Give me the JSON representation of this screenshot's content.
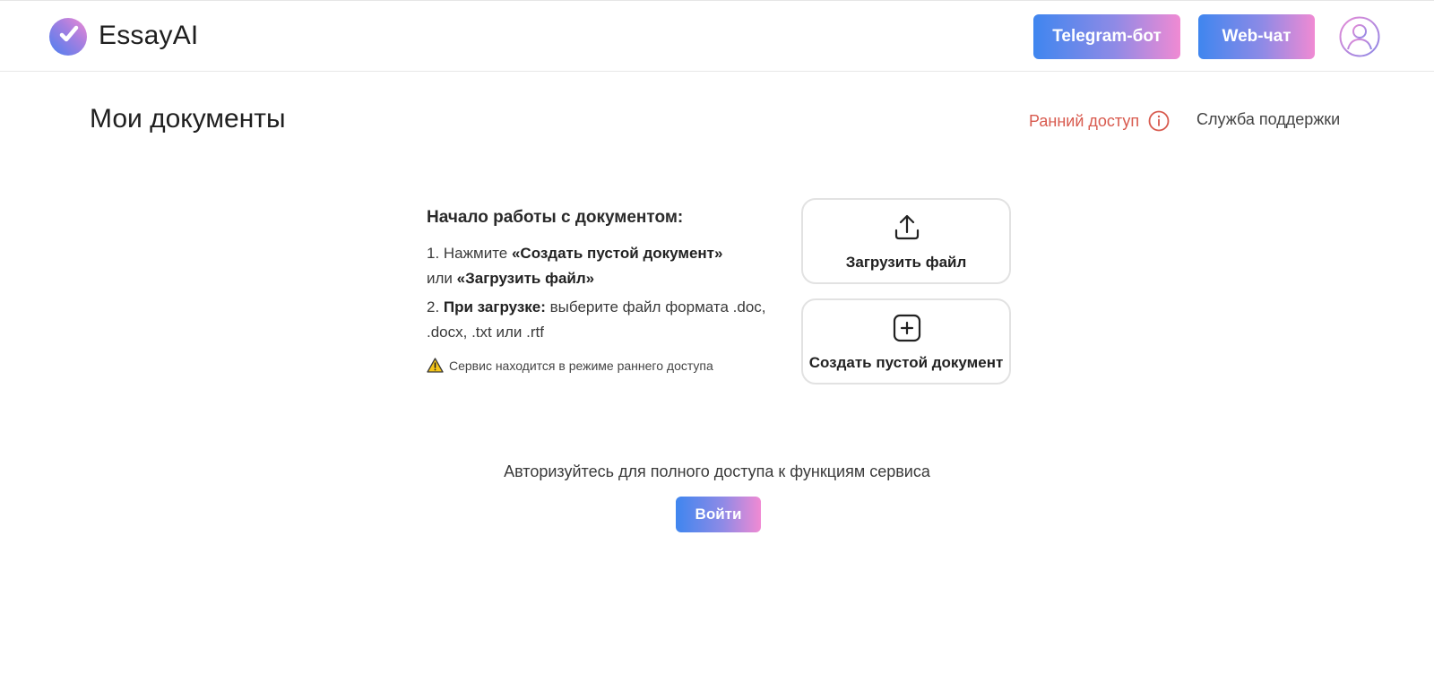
{
  "header": {
    "brand": "EssayAI",
    "telegram_label": "Telegram-бот",
    "webchat_label": "Web-чат"
  },
  "page": {
    "title": "Мои документы",
    "early_access": "Ранний доступ",
    "support": "Служба поддержки"
  },
  "instructions": {
    "title": "Начало работы с документом:",
    "step1_prefix": "1. Нажмите ",
    "step1_bold1": "«Создать пустой документ»",
    "step1_mid": "или ",
    "step1_bold2": "«Загрузить файл»",
    "step2_prefix": "2. ",
    "step2_bold": "При загрузке:",
    "step2_text": " выберите файл формата .doc, .docx, .txt или .rtf",
    "warning": "Сервис находится в режиме раннего доступа"
  },
  "cards": {
    "upload_label": "Загрузить файл",
    "create_label": "Создать пустой документ"
  },
  "auth": {
    "text": "Авторизуйтесь для полного доступа к функциям сервиса",
    "login_label": "Войти"
  },
  "colors": {
    "gradient_start": "#3f86ef",
    "gradient_end": "#f08ad3",
    "early_access": "#d85a4e"
  }
}
